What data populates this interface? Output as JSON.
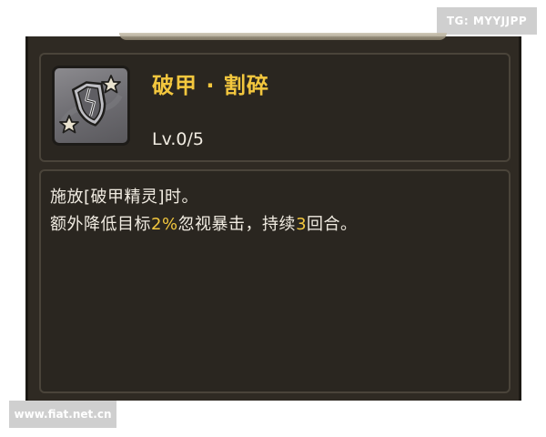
{
  "watermarks": {
    "top_right": "TG: MYYJJPP",
    "bottom_left": "www.fiat.net.cn"
  },
  "skill": {
    "icon": "cracked-shield-icon",
    "name": "破甲 · 割碎",
    "level": "Lv.0/5"
  },
  "description": {
    "line1": "施放[破甲精灵]时。",
    "line2_prefix": "额外降低目标",
    "line2_value1": "2%",
    "line2_middle": "忽视暴击，持续",
    "line2_value2": "3",
    "line2_suffix": "回合。"
  },
  "colors": {
    "panel_bg": "#2f2a23",
    "title_gold": "#f3c73e",
    "text_light": "#f1ece2"
  }
}
